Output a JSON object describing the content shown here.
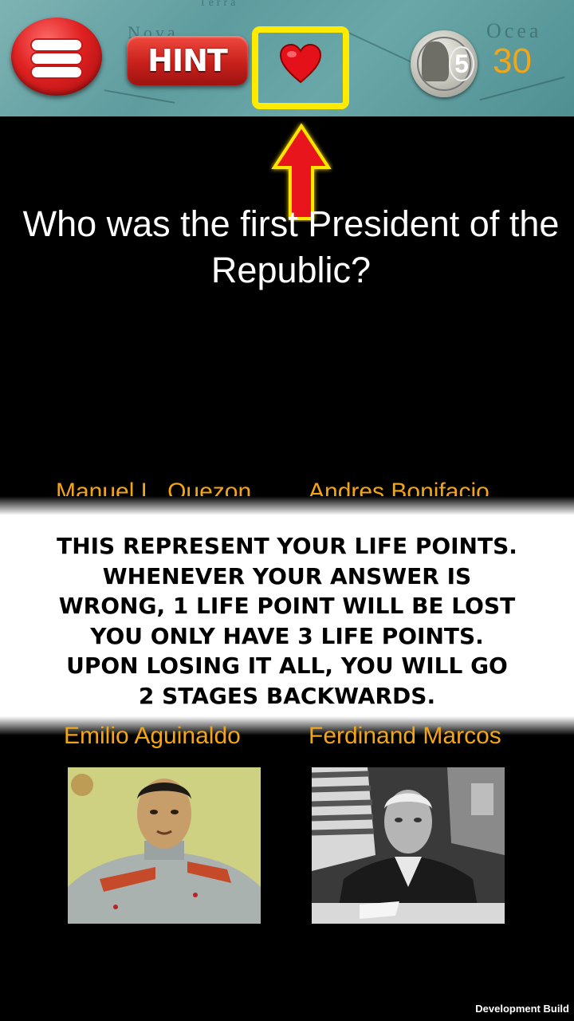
{
  "header": {
    "hint_label": "HINT",
    "coins": "30",
    "coin_denomination": "5",
    "map_text_1": "Terra",
    "map_text_2": "Nova",
    "map_text_3": "Ocea"
  },
  "question": "Who was the first President of the Republic?",
  "options": [
    "Manuel L. Quezon",
    "Andres Bonifacio",
    "Emilio Aguinaldo",
    "Ferdinand Marcos"
  ],
  "tutorial": {
    "lines": [
      "THIS REPRESENT YOUR LIFE POINTS.",
      "WHENEVER YOUR ANSWER IS",
      "WRONG, 1 LIFE POINT WILL BE LOST",
      "YOU ONLY HAVE 3 LIFE POINTS.",
      "UPON LOSING IT ALL, YOU WILL GO",
      "2 STAGES BACKWARDS."
    ]
  },
  "footer": {
    "build_label": "Development Build"
  },
  "colors": {
    "accent": "#f2a516",
    "highlight": "#ffeb00",
    "button_red": "#d8251f"
  }
}
